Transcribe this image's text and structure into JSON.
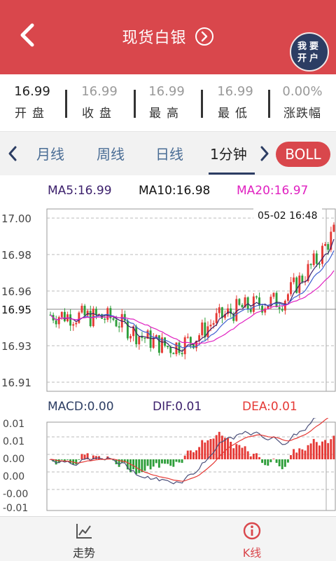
{
  "header": {
    "title": "现货白银",
    "open_account_line1": "我要",
    "open_account_line2": "开户"
  },
  "stats": [
    {
      "value": "16.99",
      "label": "开盘"
    },
    {
      "value": "16.99",
      "label": "收盘"
    },
    {
      "value": "16.99",
      "label": "最高"
    },
    {
      "value": "16.99",
      "label": "最低"
    },
    {
      "value": "0.00%",
      "label": "涨跌幅"
    }
  ],
  "tabs": [
    {
      "label": "月线"
    },
    {
      "label": "周线"
    },
    {
      "label": "日线"
    },
    {
      "label": "1分钟"
    }
  ],
  "indicator_button": "BOLL",
  "ma_legend": {
    "ma5": "MA5:16.99",
    "ma10": "MA10:16.98",
    "ma20": "MA20:16.97"
  },
  "macd_legend": {
    "macd": "MACD:0.00",
    "dif": "DIF:0.01",
    "dea": "DEA:0.01"
  },
  "price_chart": {
    "timestamp": "05-02 16:48",
    "current_price_label": "16.95",
    "y_ticks": [
      "17.00",
      "16.98",
      "16.96",
      "16.95",
      "16.93",
      "16.91"
    ]
  },
  "macd_chart": {
    "y_ticks": [
      "0.01",
      "0.01",
      "0.00",
      "0.00",
      "-0.00",
      "-0.01"
    ]
  },
  "bottom_nav": [
    {
      "label": "走势"
    },
    {
      "label": "K线"
    }
  ],
  "colors": {
    "brand": "#d9474c",
    "navy": "#2c3d63",
    "up": "#e53935",
    "down": "#2e9e3a",
    "ma5": "#3b1f6b",
    "ma10": "#111111",
    "ma20": "#e020c0",
    "dif": "#4a4f7a",
    "dea": "#e53935"
  },
  "chart_data": {
    "type": "candlestick",
    "y_range_price": [
      16.905,
      17.005
    ],
    "ma5_last": 16.99,
    "ma10_last": 16.98,
    "ma20_last": 16.97,
    "macd_last": 0.0,
    "dif_last": 0.01,
    "dea_last": 0.01
  }
}
